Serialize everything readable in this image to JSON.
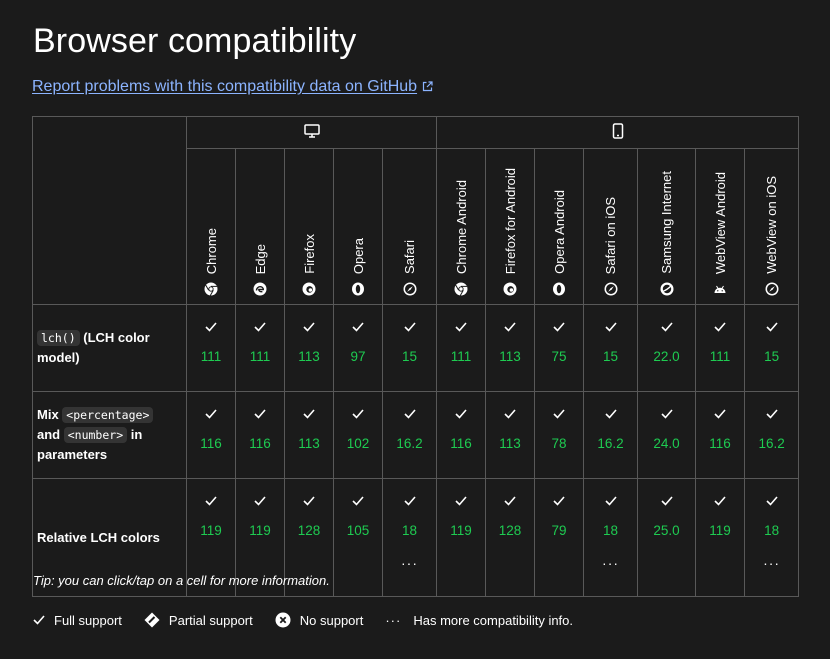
{
  "title": "Browser compatibility",
  "report_link": "Report problems with this compatibility data on GitHub",
  "platforms": [
    {
      "name": "desktop",
      "icon": "desktop-icon"
    },
    {
      "name": "mobile",
      "icon": "mobile-icon"
    }
  ],
  "browsers": [
    {
      "name": "Chrome",
      "icon": "chrome-icon"
    },
    {
      "name": "Edge",
      "icon": "edge-icon"
    },
    {
      "name": "Firefox",
      "icon": "firefox-icon"
    },
    {
      "name": "Opera",
      "icon": "opera-icon"
    },
    {
      "name": "Safari",
      "icon": "safari-icon"
    },
    {
      "name": "Chrome Android",
      "icon": "chrome-icon"
    },
    {
      "name": "Firefox for Android",
      "icon": "firefox-icon"
    },
    {
      "name": "Opera Android",
      "icon": "opera-icon"
    },
    {
      "name": "Safari on iOS",
      "icon": "safari-icon"
    },
    {
      "name": "Samsung Internet",
      "icon": "samsung-internet-icon"
    },
    {
      "name": "WebView Android",
      "icon": "android-icon"
    },
    {
      "name": "WebView on iOS",
      "icon": "safari-icon"
    }
  ],
  "features": [
    {
      "code1": "lch()",
      "text1": " (LCH color model)",
      "versions": [
        "111",
        "111",
        "113",
        "97",
        "15",
        "111",
        "113",
        "75",
        "15",
        "22.0",
        "111",
        "15"
      ],
      "more": [
        "",
        "",
        "",
        "",
        "",
        "",
        "",
        "",
        "",
        "",
        "",
        ""
      ]
    },
    {
      "prefix": "Mix ",
      "code1": "<percentage>",
      "mid": " and ",
      "code2": "<number>",
      "suffix": " in parameters",
      "versions": [
        "116",
        "116",
        "113",
        "102",
        "16.2",
        "116",
        "113",
        "78",
        "16.2",
        "24.0",
        "116",
        "16.2"
      ],
      "more": [
        "",
        "",
        "",
        "",
        "",
        "",
        "",
        "",
        "",
        "",
        "",
        ""
      ]
    },
    {
      "label": "Relative LCH colors",
      "versions": [
        "119",
        "119",
        "128",
        "105",
        "18",
        "119",
        "128",
        "79",
        "18",
        "25.0",
        "119",
        "18"
      ],
      "more": [
        "",
        "",
        "",
        "",
        "···",
        "",
        "",
        "",
        "···",
        "",
        "",
        "···"
      ]
    }
  ],
  "tip": "Tip: you can click/tap on a cell for more information.",
  "legend": {
    "full": "Full support",
    "partial": "Partial support",
    "none": "No support",
    "more": "Has more compatibility info."
  },
  "colors": {
    "background": "#1b1b1b",
    "link": "#8cb4ff",
    "supported": "#1ecb51",
    "border": "#595959"
  }
}
